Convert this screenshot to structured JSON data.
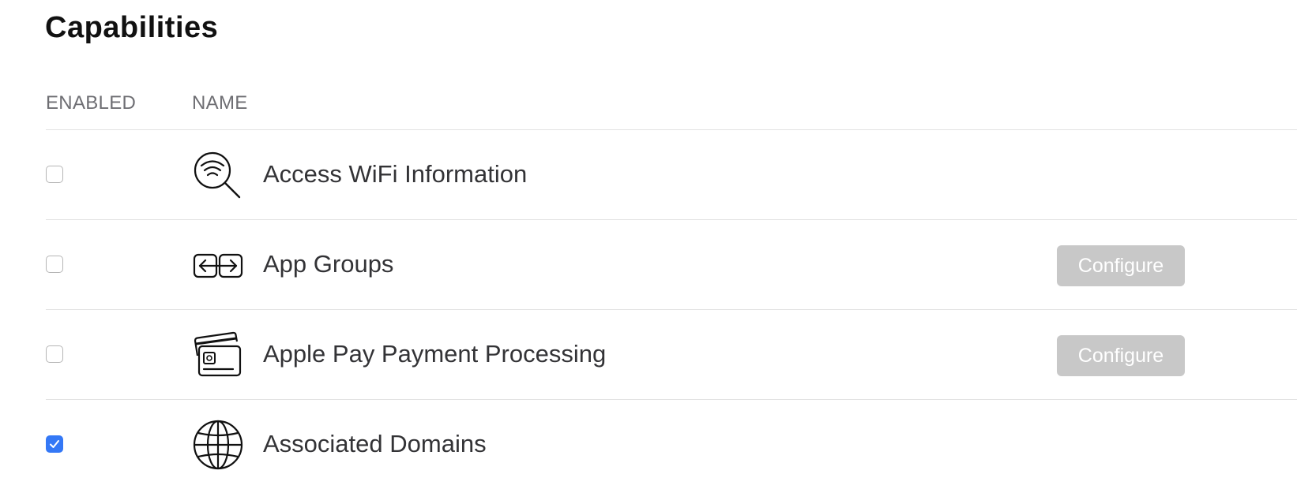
{
  "page": {
    "title": "Capabilities"
  },
  "table": {
    "headers": {
      "enabled": "ENABLED",
      "name": "NAME"
    },
    "rows": [
      {
        "name": "Access WiFi Information",
        "enabled": false,
        "icon": "wifi-search-icon",
        "configure_label": ""
      },
      {
        "name": "App Groups",
        "enabled": false,
        "icon": "app-groups-icon",
        "configure_label": "Configure"
      },
      {
        "name": "Apple Pay Payment Processing",
        "enabled": false,
        "icon": "payment-cards-icon",
        "configure_label": "Configure"
      },
      {
        "name": "Associated Domains",
        "enabled": true,
        "icon": "globe-icon",
        "configure_label": ""
      }
    ]
  },
  "colors": {
    "checkbox_checked": "#3478f6",
    "button_disabled_bg": "#c8c8c8",
    "divider": "#e2e2e2"
  }
}
